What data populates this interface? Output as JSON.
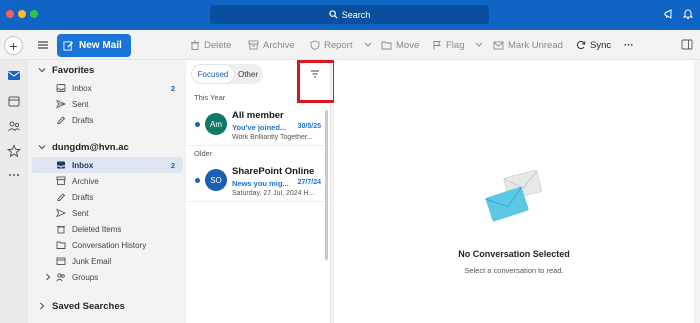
{
  "titlebar": {
    "search_label": "Search"
  },
  "toolbar": {
    "new_mail": "New Mail",
    "delete": "Delete",
    "archive": "Archive",
    "report": "Report",
    "move": "Move",
    "flag": "Flag",
    "mark_unread": "Mark Unread",
    "sync": "Sync",
    "more": "···"
  },
  "folders": {
    "favorites_label": "Favorites",
    "favorites": [
      {
        "label": "Inbox",
        "count": "2",
        "icon": "inbox-icon"
      },
      {
        "label": "Sent",
        "count": "",
        "icon": "send-icon"
      },
      {
        "label": "Drafts",
        "count": "",
        "icon": "draft-icon"
      }
    ],
    "account_label": "dungdm@hvn.ac",
    "account_items": [
      {
        "label": "Inbox",
        "count": "2",
        "icon": "inbox-icon",
        "selected": true
      },
      {
        "label": "Archive",
        "count": "",
        "icon": "archive-icon"
      },
      {
        "label": "Drafts",
        "count": "",
        "icon": "draft-icon"
      },
      {
        "label": "Sent",
        "count": "",
        "icon": "send-icon"
      },
      {
        "label": "Deleted Items",
        "count": "",
        "icon": "trash-icon"
      },
      {
        "label": "Conversation History",
        "count": "",
        "icon": "folder-icon"
      },
      {
        "label": "Junk Email",
        "count": "",
        "icon": "junk-icon"
      },
      {
        "label": "Groups",
        "count": "",
        "icon": "groups-icon"
      }
    ],
    "saved_searches_label": "Saved Searches"
  },
  "message_list": {
    "tab_focused": "Focused",
    "tab_other": "Other",
    "section_this_year": "This Year",
    "section_older": "Older",
    "messages": [
      {
        "initials": "Am",
        "avatar_color": "#117865",
        "sender": "All member",
        "subject": "You've joined...",
        "date": "30/5/25",
        "preview": "Work Brilliantly Together..."
      },
      {
        "initials": "SO",
        "avatar_color": "#1a5fb4",
        "sender": "SharePoint Online",
        "subject": "News you mig...",
        "date": "27/7/24",
        "preview": "Saturday, 27 Jul, 2024 H..."
      }
    ]
  },
  "reading_pane": {
    "empty_title": "No Conversation Selected",
    "empty_subtitle": "Select a conversation to read."
  },
  "colors": {
    "brand": "#1064c4",
    "accent": "#1a73d6",
    "highlight": "#d8171e"
  }
}
